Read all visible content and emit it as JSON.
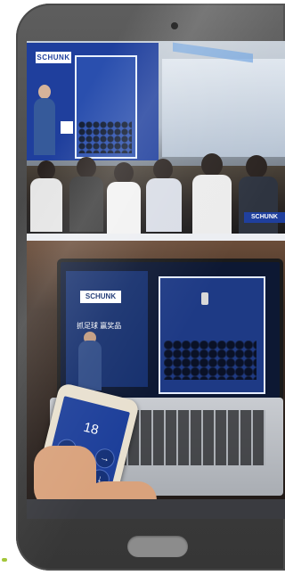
{
  "top_photo": {
    "booth_logo": "SCHUNK",
    "corner_badge": "SCHUNK"
  },
  "bottom_photo": {
    "laptop_logo": "SCHUNK",
    "laptop_slogan": "抓足球 赢奖品",
    "phone_counter": "18",
    "phone_buttons": {
      "left": "←",
      "right": "→",
      "confirm": "✓",
      "down": "↓"
    }
  },
  "colors": {
    "phone_frame": "#4a4a4a",
    "brand_blue": "#1f3f9d",
    "home_button": "#8c8c8c",
    "accent_green": "#a3c63a"
  }
}
